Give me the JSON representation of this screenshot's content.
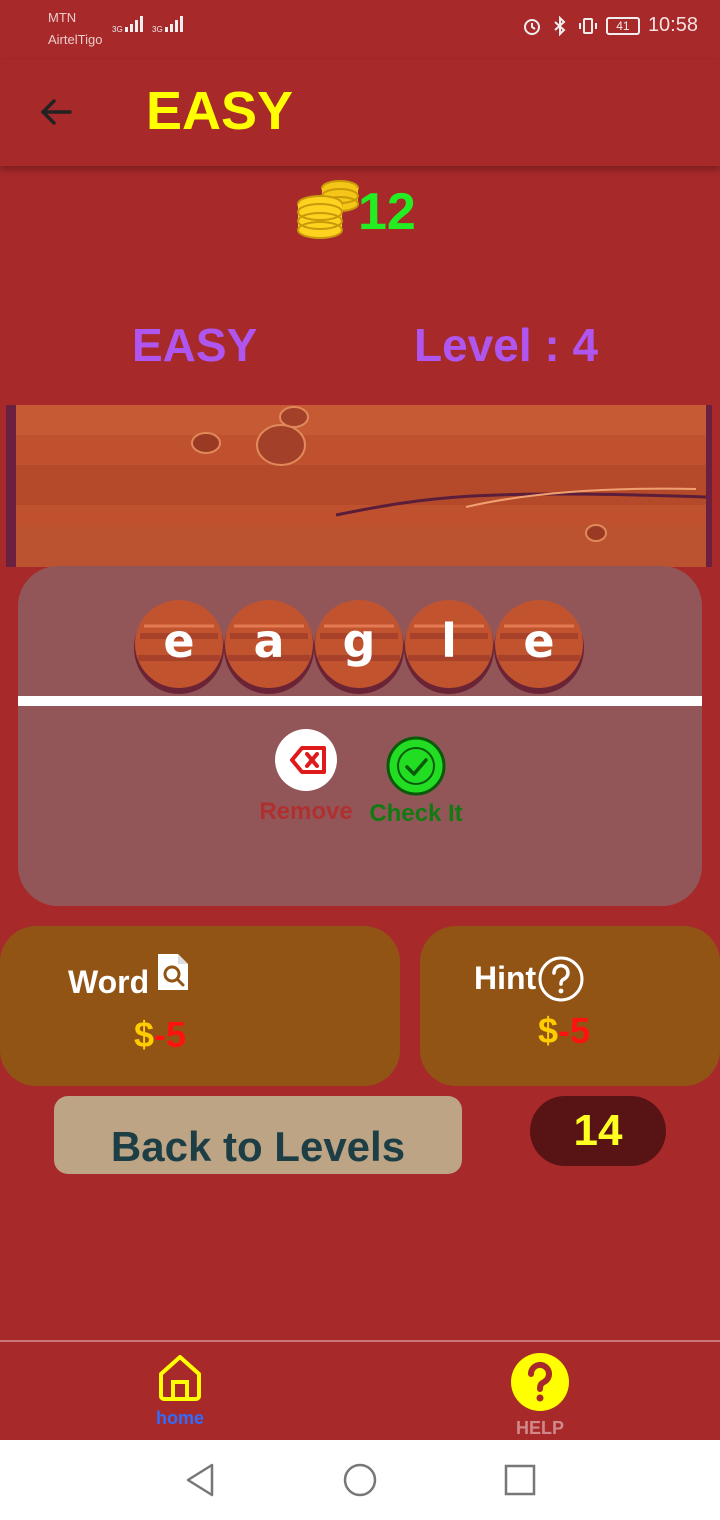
{
  "status_bar": {
    "carrier1": "MTN",
    "carrier2": "AirtelTigo",
    "signal1": "3G",
    "signal2": "3G",
    "battery": "41",
    "time": "10:58"
  },
  "app_bar": {
    "title": "EASY"
  },
  "coins": {
    "count": "12"
  },
  "level_row": {
    "difficulty": "EASY",
    "level": "Level : 4"
  },
  "word_tiles": [
    "e",
    "a",
    "g",
    "l",
    "e"
  ],
  "actions": {
    "remove": "Remove",
    "check": "Check It"
  },
  "word_card": {
    "title": "Word",
    "dollar": "$",
    "cost": "-5"
  },
  "hint_card": {
    "title": "Hint",
    "dollar": "$",
    "cost": "-5"
  },
  "back_to_levels": "Back to Levels",
  "counter": "14",
  "bottom_nav": {
    "home": "home",
    "help": "HELP"
  },
  "colors": {
    "background": "#a7292a",
    "title_yellow": "#ffff00",
    "coin_green": "#22ee22",
    "level_purple": "#b056f0",
    "card_brown": "#925415",
    "panel": "#925659"
  }
}
